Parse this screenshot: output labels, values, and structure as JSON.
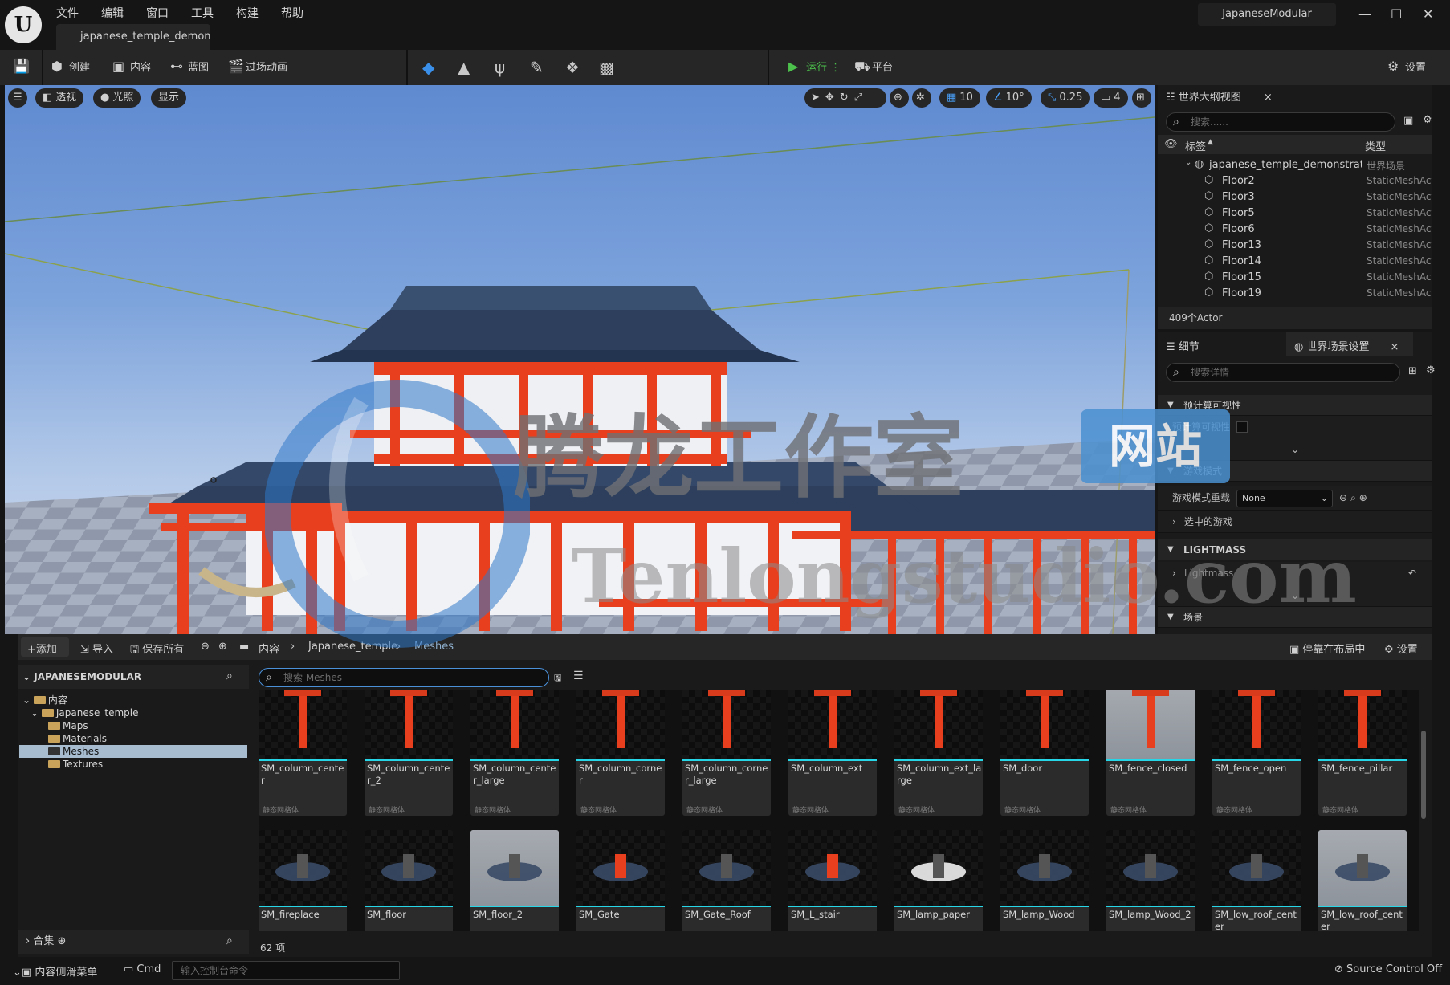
{
  "menu": [
    "文件",
    "编辑",
    "窗口",
    "工具",
    "构建",
    "帮助"
  ],
  "doc_tab": "japanese_temple_demonst",
  "project_name": "JapaneseModular",
  "window_controls": {
    "minimize": "—",
    "maximize": "☐",
    "close": "✕"
  },
  "toolbar": {
    "create": "创建",
    "content": "内容",
    "blueprint": "蓝图",
    "cinematics": "过场动画",
    "run": "运行",
    "platform": "平台",
    "settings": "设置"
  },
  "viewport": {
    "perspective": "透视",
    "lit": "光照",
    "show": "显示",
    "grid_snap": "10",
    "rotation_snap": "10°",
    "scale_snap": "0.25",
    "camera_speed": "4"
  },
  "outliner": {
    "title": "世界大纲视图",
    "search_placeholder": "搜索......",
    "col_label": "标签",
    "col_type": "类型",
    "root": {
      "name": "japanese_temple_demonstration",
      "type": "世界场景"
    },
    "rows": [
      {
        "name": "Floor2",
        "type": "StaticMeshActor"
      },
      {
        "name": "Floor3",
        "type": "StaticMeshActor"
      },
      {
        "name": "Floor5",
        "type": "StaticMeshActor"
      },
      {
        "name": "Floor6",
        "type": "StaticMeshActor"
      },
      {
        "name": "Floor13",
        "type": "StaticMeshActor"
      },
      {
        "name": "Floor14",
        "type": "StaticMeshActor"
      },
      {
        "name": "Floor15",
        "type": "StaticMeshActor"
      },
      {
        "name": "Floor19",
        "type": "StaticMeshActor"
      }
    ],
    "count": "409个Actor"
  },
  "details": {
    "tab_details": "细节",
    "tab_world": "世界场景设置",
    "search_placeholder": "搜索详情",
    "sec_precompute": "预计算可视性",
    "prop_precompute": "预计算可视性",
    "sec_gamemode": "游戏模式",
    "prop_gamemode_override": "游戏模式重载",
    "gamemode_value": "None",
    "prop_selected_gamemode": "选中的游戏",
    "sec_lightmass": "LIGHTMASS",
    "prop_lightmass": "Lightmass",
    "sec_scene": "场景"
  },
  "content_browser": {
    "add": "添加",
    "import": "导入",
    "save_all": "保存所有",
    "path": [
      "内容",
      "Japanese_temple",
      "Meshes"
    ],
    "dock": "停靠在布局中",
    "settings": "设置",
    "root": "JAPANESEMODULAR",
    "tree": [
      "内容",
      "Japanese_temple",
      "Maps",
      "Materials",
      "Meshes",
      "Textures"
    ],
    "collections": "合集",
    "search_placeholder": "搜索 Meshes",
    "item_count": "62 项",
    "asset_type": "静态网格体",
    "assets_row1": [
      "SM_column_center",
      "SM_column_center_2",
      "SM_column_center_large",
      "SM_column_corner",
      "SM_column_corner_large",
      "SM_column_ext",
      "SM_column_ext_large",
      "SM_door",
      "SM_fence_closed",
      "SM_fence_open",
      "SM_fence_pillar"
    ],
    "assets_row2": [
      "SM_fireplace",
      "SM_floor",
      "SM_floor_2",
      "SM_Gate",
      "SM_Gate_Roof",
      "SM_L_stair",
      "SM_lamp_paper",
      "SM_lamp_Wood",
      "SM_lamp_Wood_2",
      "SM_low_roof_center",
      "SM_low_roof_center"
    ]
  },
  "statusbar": {
    "drawer": "内容侧滑菜单",
    "cmd": "Cmd",
    "console_placeholder": "输入控制台命令",
    "source_control": "Source Control Off"
  },
  "watermark": {
    "cn": "腾龙工作室",
    "badge": "网站",
    "en": "Tenlongstudio.com"
  },
  "colors": {
    "accent_cyan": "#27d7e8",
    "run_green": "#4cc24c",
    "temple_red": "#e8401e",
    "roof_blue": "#2d3f5c"
  }
}
